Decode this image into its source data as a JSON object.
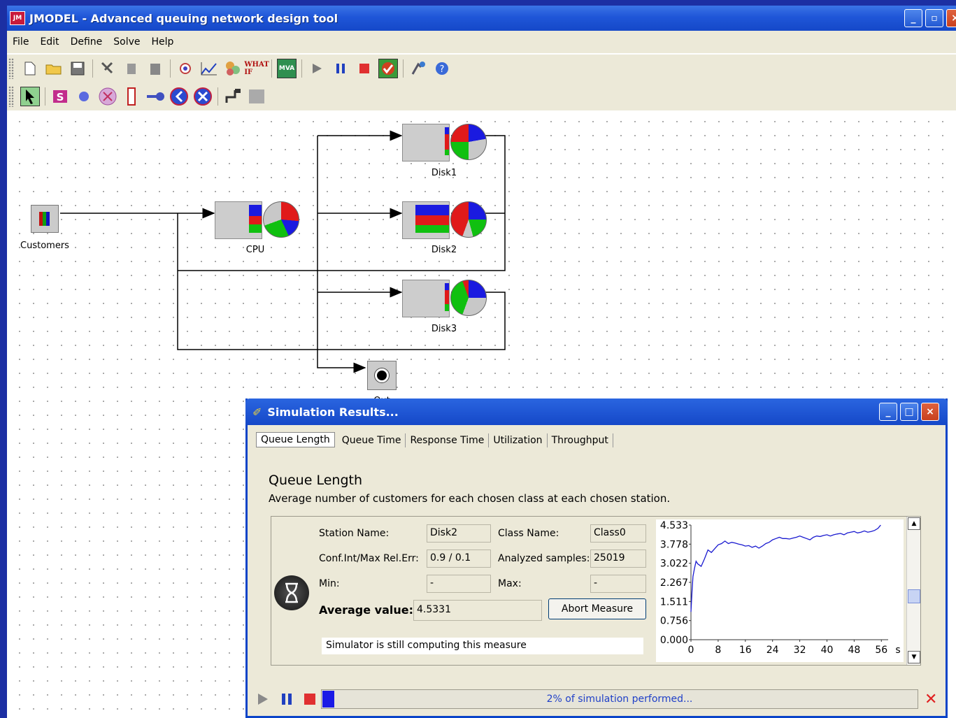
{
  "window": {
    "title": "JMODEL - Advanced queuing network design tool"
  },
  "menu": [
    "File",
    "Edit",
    "Define",
    "Solve",
    "Help"
  ],
  "toolbar1_icons": [
    "new-file-icon",
    "open-folder-icon",
    "save-icon",
    "cut-icon",
    "copy-icon",
    "paste-icon",
    "class-icon",
    "measures-icon",
    "parameters-icon",
    "what-if-icon",
    "mva-icon",
    "play-icon",
    "pause-icon",
    "stop-icon",
    "results-icon",
    "solve-options-icon",
    "help-icon"
  ],
  "toolbar1_mva": "MVA",
  "toolbar1_whatif": "WHAT IF",
  "toolbar2_icons": [
    "select-arrow-icon",
    "source-icon",
    "server-icon",
    "delay-icon",
    "router-icon",
    "sink-icon",
    "fork-icon",
    "join-icon",
    "connect-icon",
    "grid-icon"
  ],
  "network": {
    "nodes": {
      "customers": "Customers",
      "cpu": "CPU",
      "disk1": "Disk1",
      "disk2": "Disk2",
      "disk3": "Disk3",
      "out": "Out"
    }
  },
  "dialog": {
    "title": "Simulation Results...",
    "tabs": [
      "Queue Length",
      "Queue Time",
      "Response Time",
      "Utilization",
      "Throughput"
    ],
    "heading": "Queue Length",
    "description": "Average number of customers for each chosen class at each chosen station.",
    "station_label": "Station Name:",
    "station_value": "Disk2",
    "class_label": "Class Name:",
    "class_value": "Class0",
    "conf_label": "Conf.Int/Max Rel.Err:",
    "conf_value": "0.9 / 0.1",
    "samples_label": "Analyzed samples:",
    "samples_value": "25019",
    "min_label": "Min:",
    "min_value": "-",
    "max_label": "Max:",
    "max_value": "-",
    "avg_label": "Average value:",
    "avg_value": "4.5331",
    "abort_label": "Abort Measure",
    "status_text": "Simulator is still computing this measure",
    "progress_text": "2% of simulation performed...",
    "progress": 0.02
  },
  "chart_data": {
    "type": "line",
    "yticks": [
      "4.533",
      "3.778",
      "3.022",
      "2.267",
      "1.511",
      "0.756",
      "0.000"
    ],
    "xticks": [
      "0",
      "8",
      "16",
      "24",
      "32",
      "40",
      "48",
      "56"
    ],
    "xunit": "s",
    "ylim": [
      0,
      4.533
    ],
    "xlim": [
      0,
      58
    ],
    "series": [
      {
        "color": "#1a1ad0",
        "x": [
          0,
          0.3,
          0.6,
          1,
          1.5,
          2,
          2.5,
          3,
          4,
          5,
          6,
          7,
          8,
          9,
          10,
          11,
          12,
          13,
          14,
          15,
          16,
          17,
          18,
          19,
          20,
          21,
          22,
          23,
          24,
          25,
          26,
          27,
          28,
          29,
          30,
          31,
          32,
          33,
          34,
          35,
          36,
          37,
          38,
          39,
          40,
          41,
          42,
          43,
          44,
          45,
          46,
          47,
          48,
          49,
          50,
          51,
          52,
          53,
          54,
          55,
          55.8
        ],
        "y": [
          1.1,
          1.9,
          2.5,
          2.8,
          3.1,
          3.0,
          2.95,
          2.9,
          3.2,
          3.55,
          3.45,
          3.6,
          3.75,
          3.8,
          3.9,
          3.8,
          3.85,
          3.82,
          3.78,
          3.75,
          3.7,
          3.72,
          3.65,
          3.7,
          3.62,
          3.7,
          3.8,
          3.85,
          3.95,
          4.0,
          4.05,
          4.0,
          4.0,
          3.98,
          4.02,
          4.05,
          4.1,
          4.05,
          4.0,
          3.95,
          4.05,
          4.1,
          4.08,
          4.12,
          4.15,
          4.1,
          4.15,
          4.18,
          4.2,
          4.15,
          4.22,
          4.25,
          4.28,
          4.22,
          4.25,
          4.3,
          4.25,
          4.28,
          4.32,
          4.4,
          4.53
        ]
      }
    ]
  }
}
